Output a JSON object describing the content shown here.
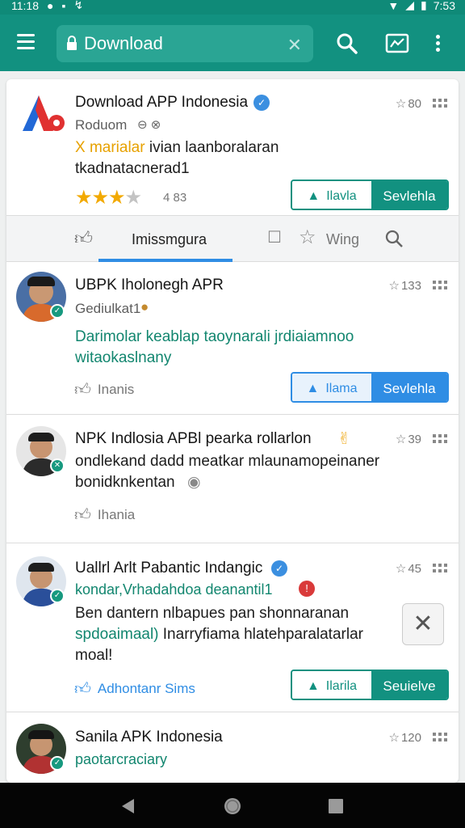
{
  "status": {
    "time": "11:18",
    "battery_text": "7:53"
  },
  "appbar": {
    "search_value": "Download"
  },
  "card1": {
    "title": "Download APP Indonesia",
    "subtitle": "Roduom",
    "rating": "80",
    "desc_highlight": "X marialar",
    "desc_rest": " ivian laanboralaran",
    "desc_line2": "tkadnatacnerad1",
    "stars_count": 3,
    "rating_count": "4 83",
    "btn_a": "Ilavla",
    "btn_b": "Sevlehla"
  },
  "tabs": {
    "tab1": "Imissmgura",
    "tab2": "Wing"
  },
  "card2": {
    "title": "UBPK Iholonegh APR",
    "rating": "133",
    "subtitle": "Gediulkat1",
    "desc_line1": "Darimolar keablap taoynarali jrdiaiamnoo",
    "desc_line2": "witaokaslnany",
    "like": "Inanis",
    "btn_a": "Ilama",
    "btn_b": "Sevlehla"
  },
  "card3": {
    "title": "NPK Indlosia APBl pearka rollarlon",
    "rating": "39",
    "line1": "ondlekand dadd meatkar mlaunamopeinaner",
    "line2": "bonidknkentan",
    "like": "Ihania"
  },
  "card4": {
    "title": "Uallrl Arlt Pabantic Indangic",
    "rating": "45",
    "line1": "kondar,Vrhadahdoa deanantil1",
    "line2": "Ben dantern nlbapues pan shonnaranan",
    "line3_a": "spdoaimaal)",
    "line3_b": " Inarryfiama hlatehparalatarlar",
    "line4": "moal!",
    "like": "Adhontanr Sims",
    "btn_a": "Ilarila",
    "btn_b": "Seuielve"
  },
  "card5": {
    "title": "Sanila APK Indonesia",
    "rating": "120",
    "subtitle": "paotarcraciary"
  },
  "colors": {
    "appbar": "#129180",
    "statusbar": "#0f8a78",
    "accent_blue": "#2f8de4",
    "star": "#f2a900"
  }
}
